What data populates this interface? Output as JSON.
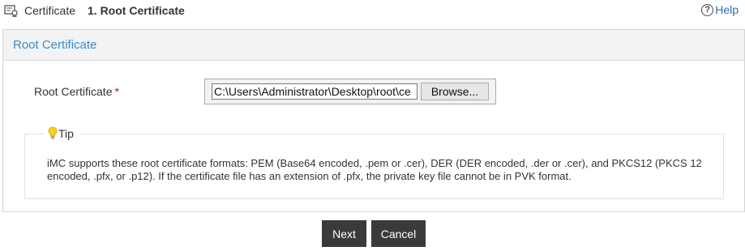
{
  "breadcrumb": {
    "icon": "certificate-icon",
    "root": "Certificate",
    "current": "1. Root Certificate"
  },
  "help": {
    "icon": "question-circle-icon",
    "label": "Help",
    "color": "#2a6fb5"
  },
  "panel": {
    "title": "Root Certificate",
    "title_color": "#3d8cc9"
  },
  "form": {
    "label": "Root Certificate",
    "required_mark": "*",
    "file_value": "C:\\Users\\Administrator\\Desktop\\root\\ce",
    "browse_label": "Browse..."
  },
  "tip": {
    "icon": "lightbulb-icon",
    "title": "Tip",
    "text": "iMC supports these root certificate formats: PEM (Base64 encoded, .pem or .cer), DER (DER encoded, .der or .cer), and PKCS12 (PKCS 12 encoded, .pfx, or .p12). If the certificate file has an extension of .pfx, the private key file cannot be in PVK format."
  },
  "actions": {
    "next_label": "Next",
    "cancel_label": "Cancel",
    "button_color": "#3a3a3a"
  }
}
